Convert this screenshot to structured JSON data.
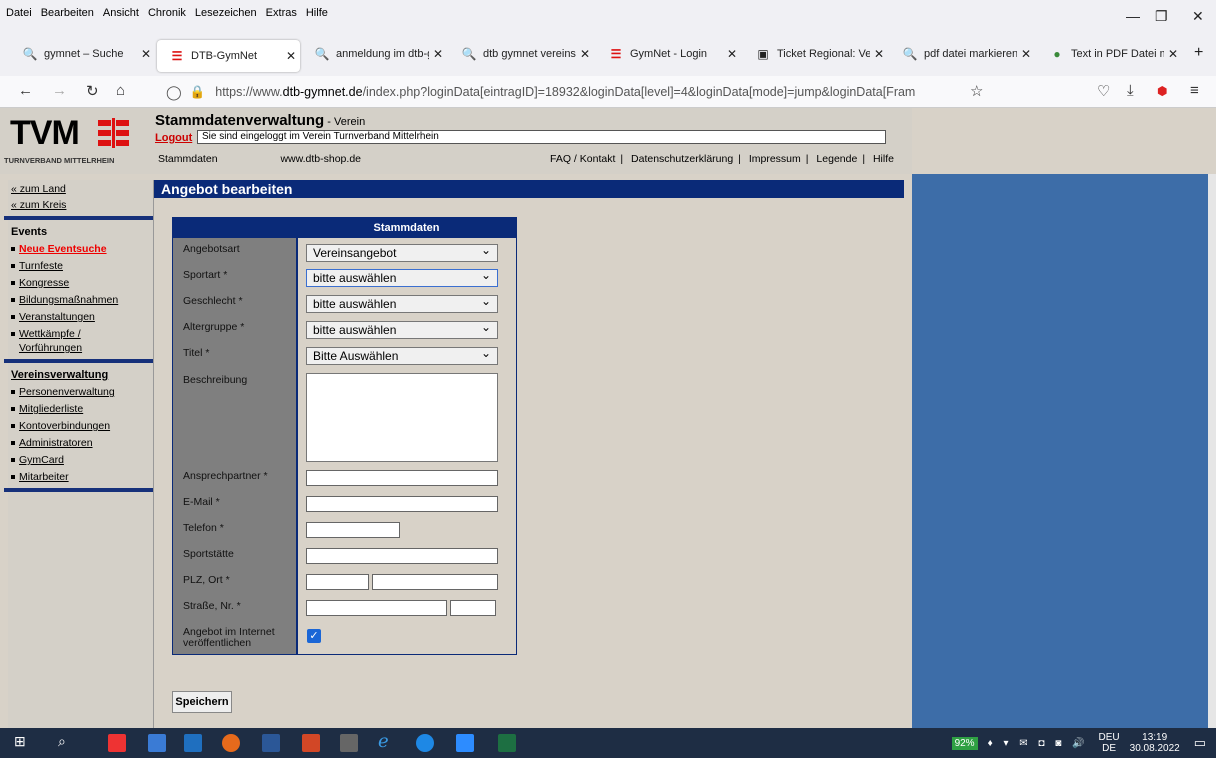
{
  "menubar": {
    "items": [
      "Datei",
      "Bearbeiten",
      "Ansicht",
      "Chronik",
      "Lesezeichen",
      "Extras",
      "Hilfe"
    ]
  },
  "tabs": [
    {
      "label": "gymnet – Suche"
    },
    {
      "label": "DTB-GymNet"
    },
    {
      "label": "anmeldung im dtb-g"
    },
    {
      "label": "dtb gymnet vereinsan"
    },
    {
      "label": "GymNet - Login"
    },
    {
      "label": "Ticket Regional: Vera"
    },
    {
      "label": "pdf datei markieren -"
    },
    {
      "label": "Text in PDF Datei mar"
    }
  ],
  "url": {
    "prefix": "https://www.",
    "domain": "dtb-gymnet.de",
    "path": "/index.php?loginData[eintragID]=18932&loginData[level]=4&loginData[mode]=jump&loginData[Fram"
  },
  "header": {
    "logo": "TVM",
    "logo_sub": "TURNVERBAND MITTELRHEIN",
    "title": "Stammdatenverwaltung",
    "title_sub": " - Verein",
    "logout": "Logout",
    "login_info": "Sie sind eingeloggt im Verein Turnverband Mittelrhein",
    "link_stammdaten": "Stammdaten",
    "link_shop": "www.dtb-shop.de",
    "link_faq": "FAQ / Kontakt",
    "link_datenschutz": "Datenschutzerklärung",
    "link_impressum": "Impressum",
    "link_legende": "Legende",
    "link_hilfe": "Hilfe",
    "sep": "|"
  },
  "sidebar": {
    "zum_land": "« zum Land",
    "zum_kreis": "« zum Kreis",
    "events_heading": "Events",
    "events": [
      "Neue Eventsuche",
      "Turnfeste",
      "Kongresse",
      "Bildungsmaßnahmen",
      "Veranstaltungen",
      "Wettkämpfe / Vorführungen"
    ],
    "verein_heading": "Vereinsverwaltung",
    "verein": [
      "Personenverwaltung",
      "Mitgliederliste",
      "Kontoverbindungen",
      "Administratoren",
      "GymCard",
      "Mitarbeiter"
    ]
  },
  "main": {
    "title": "Angebot bearbeiten"
  },
  "form": {
    "header": "Stammdaten",
    "angebotsart_label": "Angebotsart",
    "angebotsart_value": "Vereinsangebot",
    "sportart_label": "Sportart *",
    "sportart_value": "bitte auswählen",
    "geschlecht_label": "Geschlecht *",
    "geschlecht_value": "bitte auswählen",
    "altersgruppe_label": "Altergruppe *",
    "altersgruppe_value": "bitte auswählen",
    "titel_label": "Titel *",
    "titel_value": "Bitte Auswählen",
    "beschreibung_label": "Beschreibung",
    "ansprech_label": "Ansprechpartner *",
    "email_label": "E-Mail *",
    "telefon_label": "Telefon *",
    "sportstaette_label": "Sportstätte",
    "plz_label": "PLZ, Ort *",
    "strasse_label": "Straße, Nr. *",
    "internet_label_1": "Angebot im Internet",
    "internet_label_2": "veröffentlichen",
    "internet_checked": true,
    "save": "Speichern"
  },
  "taskbar": {
    "battery": "92%",
    "lang": "DEU",
    "lang_sub": "DE",
    "time": "13:19",
    "date": "30.08.2022"
  }
}
